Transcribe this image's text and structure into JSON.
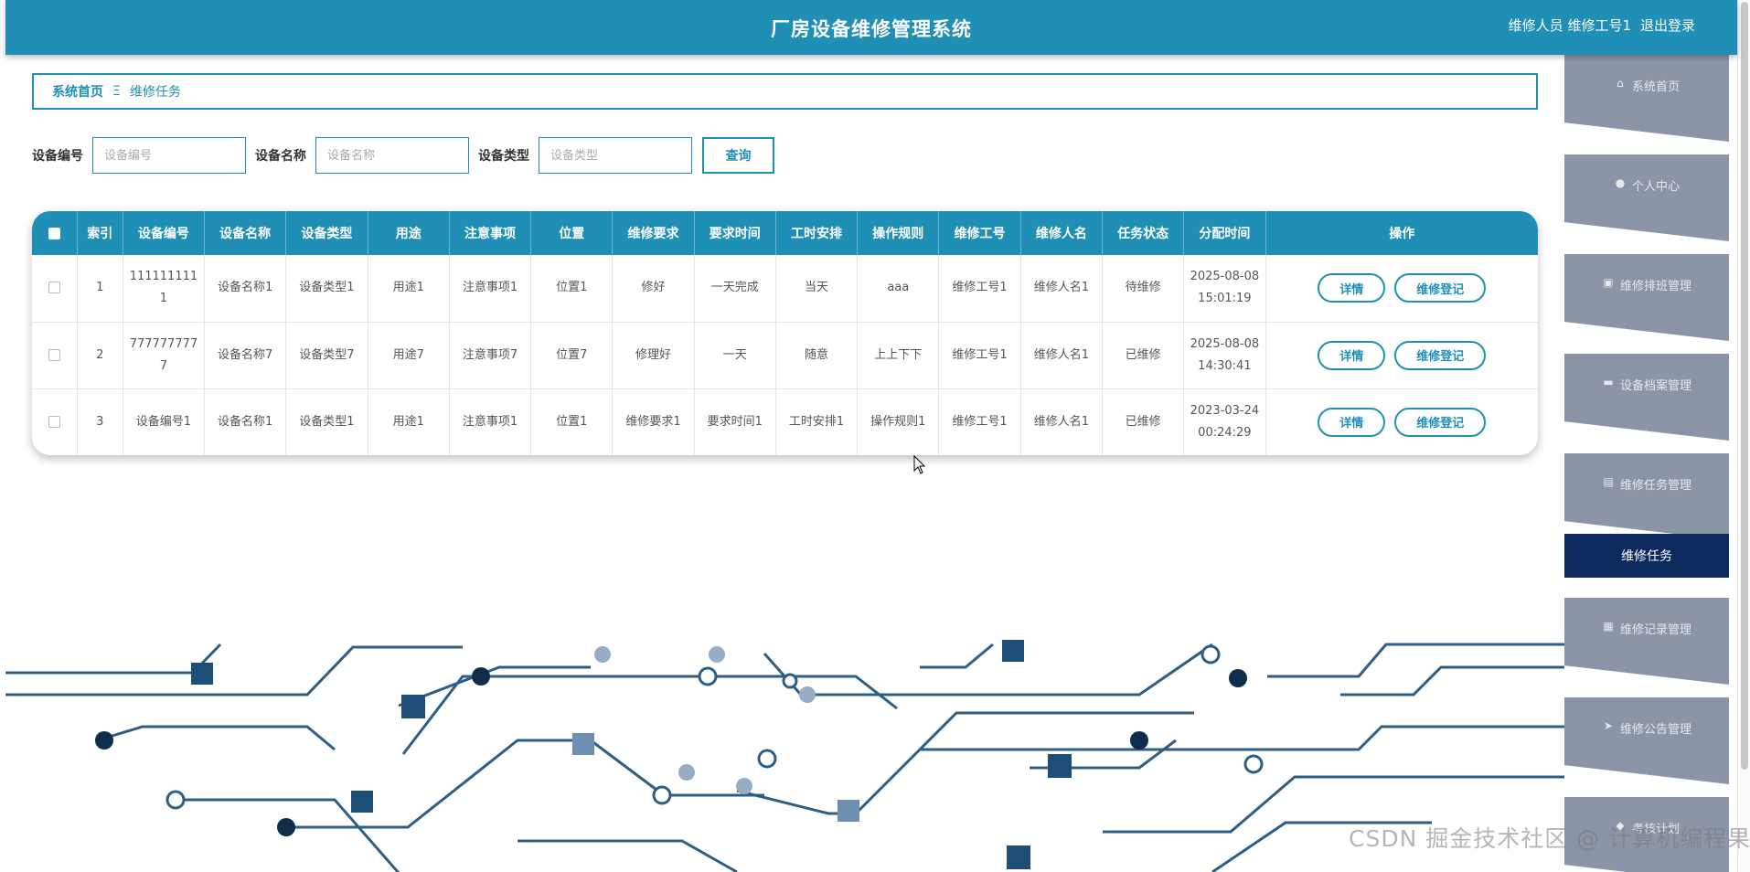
{
  "header": {
    "title": "厂房设备维修管理系统",
    "user_label": "维修人员 维修工号1",
    "logout": "退出登录"
  },
  "breadcrumb": {
    "home": "系统首页",
    "separator": "Ξ",
    "current": "维修任务"
  },
  "search": {
    "fields": [
      {
        "label": "设备编号",
        "placeholder": "设备编号"
      },
      {
        "label": "设备名称",
        "placeholder": "设备名称"
      },
      {
        "label": "设备类型",
        "placeholder": "设备类型"
      }
    ],
    "button": "查询"
  },
  "table": {
    "columns": [
      "索引",
      "设备编号",
      "设备名称",
      "设备类型",
      "用途",
      "注意事项",
      "位置",
      "维修要求",
      "要求时间",
      "工时安排",
      "操作规则",
      "维修工号",
      "维修人名",
      "任务状态",
      "分配时间",
      "操作"
    ],
    "rows": [
      [
        "1",
        "1111111111",
        "设备名称1",
        "设备类型1",
        "用途1",
        "注意事项1",
        "位置1",
        "修好",
        "一天完成",
        "当天",
        "aaa",
        "维修工号1",
        "维修人名1",
        "待维修",
        "2025-08-08 15:01:19"
      ],
      [
        "2",
        "7777777777",
        "设备名称7",
        "设备类型7",
        "用途7",
        "注意事项7",
        "位置7",
        "修理好",
        "一天",
        "随意",
        "上上下下",
        "维修工号1",
        "维修人名1",
        "已维修",
        "2025-08-08 14:30:41"
      ],
      [
        "3",
        "设备编号1",
        "设备名称1",
        "设备类型1",
        "用途1",
        "注意事项1",
        "位置1",
        "维修要求1",
        "要求时间1",
        "工时安排1",
        "操作规则1",
        "维修工号1",
        "维修人名1",
        "已维修",
        "2023-03-24 00:24:29"
      ]
    ],
    "detail_label": "详情",
    "register_label": "维修登记"
  },
  "sidebar": {
    "items": [
      {
        "label": "系统首页",
        "icon": "home-icon"
      },
      {
        "label": "个人中心",
        "icon": "user-icon"
      },
      {
        "label": "维修排班管理",
        "icon": "clipboard-icon"
      },
      {
        "label": "设备档案管理",
        "icon": "ticket-icon"
      },
      {
        "label": "维修任务管理",
        "icon": "checklist-icon"
      },
      {
        "label": "维修记录管理",
        "icon": "record-icon"
      },
      {
        "label": "维修公告管理",
        "icon": "send-icon"
      },
      {
        "label": "考核计划",
        "icon": "plan-icon"
      }
    ],
    "active_sub": "维修任务"
  },
  "watermark": "CSDN 掘金技术社区 @ 计算机编程果茶熊",
  "colors": {
    "primary": "#1f8fb6",
    "nav": "#8c95a8",
    "active": "#0d2a5e"
  }
}
